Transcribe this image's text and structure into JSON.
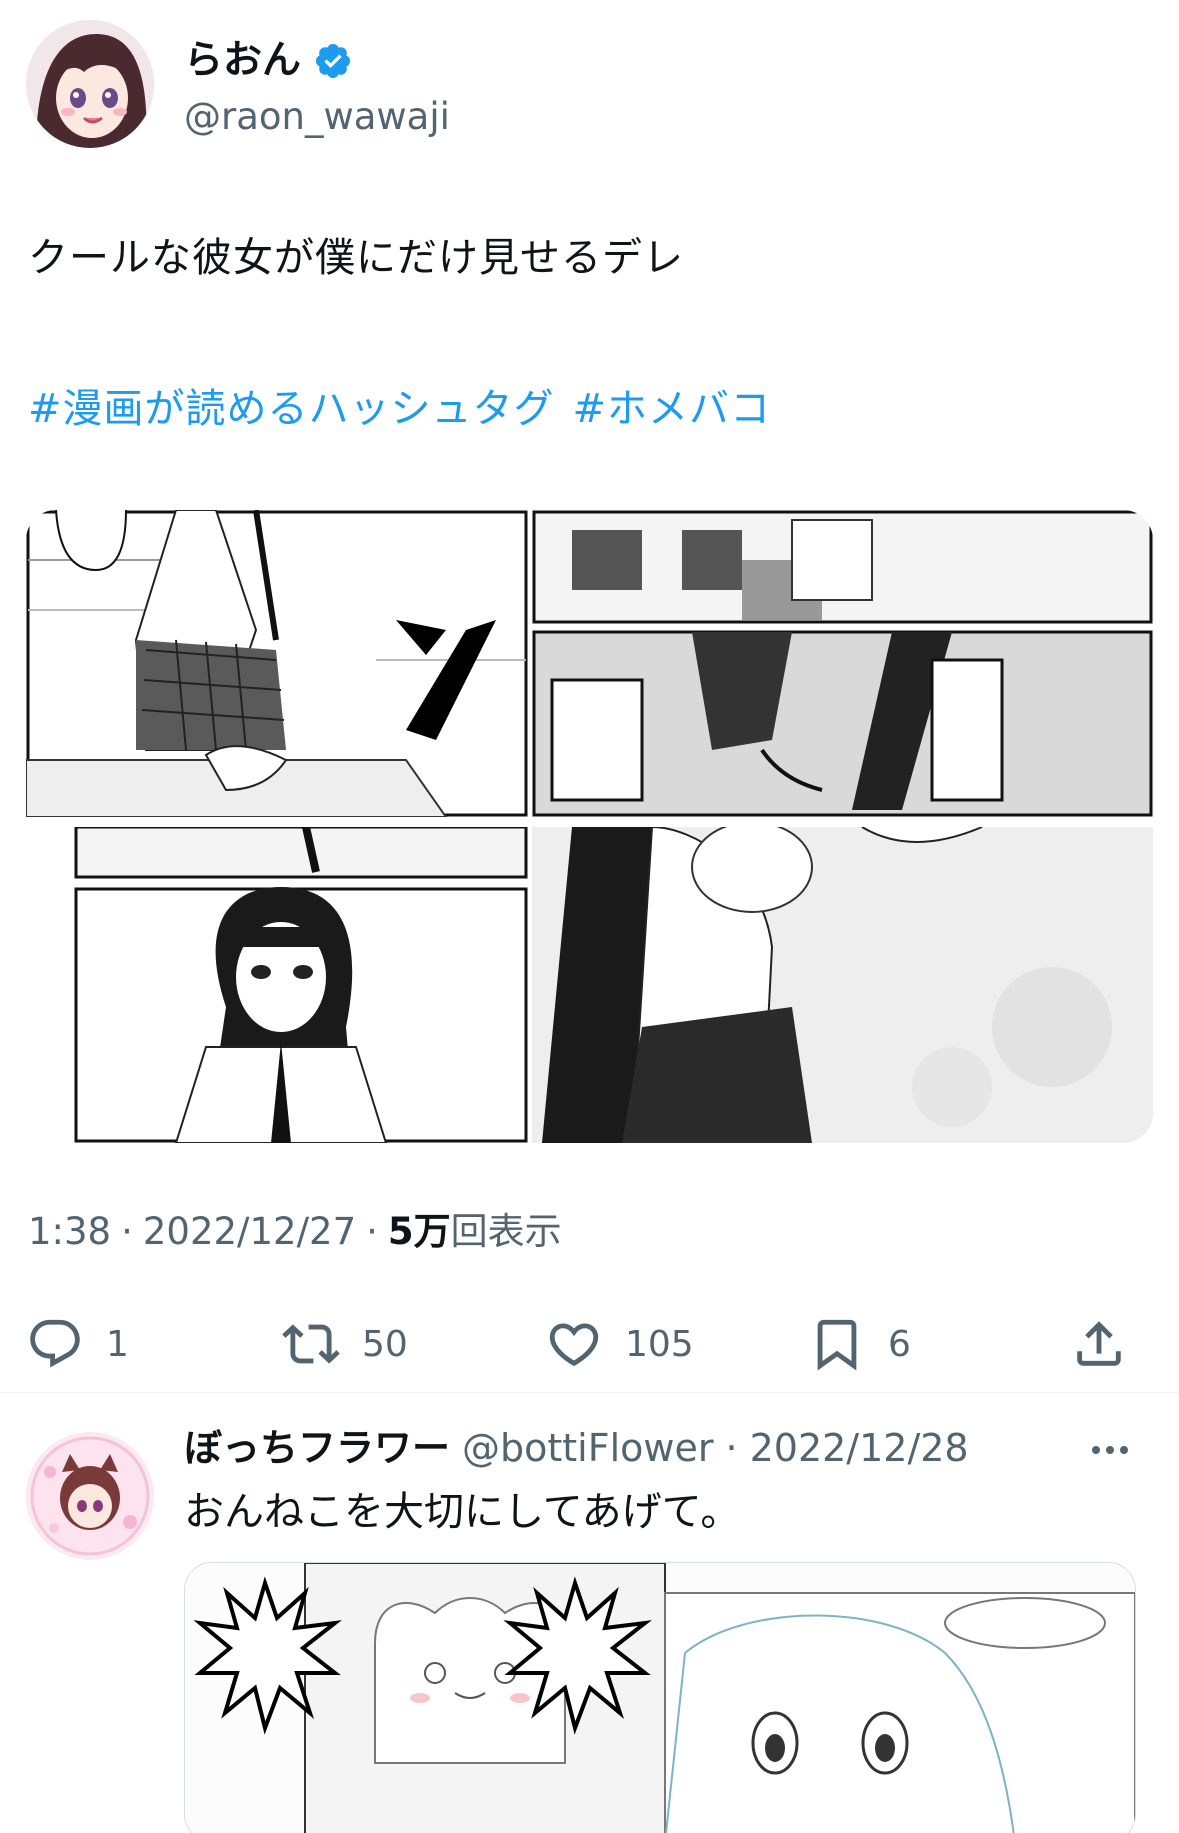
{
  "tweet": {
    "author_name": "らおん",
    "author_handle": "@raon_wawaji",
    "verified_icon": "verified-badge-icon",
    "text": "クールな彼女が僕にだけ見せるデレ",
    "hashtags": [
      "#漫画が読めるハッシュタグ",
      "#ホメバコ"
    ],
    "time": "1:38",
    "sep1": "·",
    "date": "2022/12/27",
    "sep2": "·",
    "views_count": "5万",
    "views_label": "回表示",
    "media_count": 4
  },
  "actions": {
    "reply_count": "1",
    "retweet_count": "50",
    "like_count": "105",
    "bookmark_count": "6"
  },
  "reply": {
    "author_name": "ぼっちフラワー",
    "author_handle": "@bottiFlower",
    "sep": "·",
    "date": "2022/12/28",
    "text": "おんねこを大切にしてあげて。"
  },
  "colors": {
    "link": "#1d9bf0",
    "secondary": "#536471",
    "primary": "#0f1419"
  }
}
